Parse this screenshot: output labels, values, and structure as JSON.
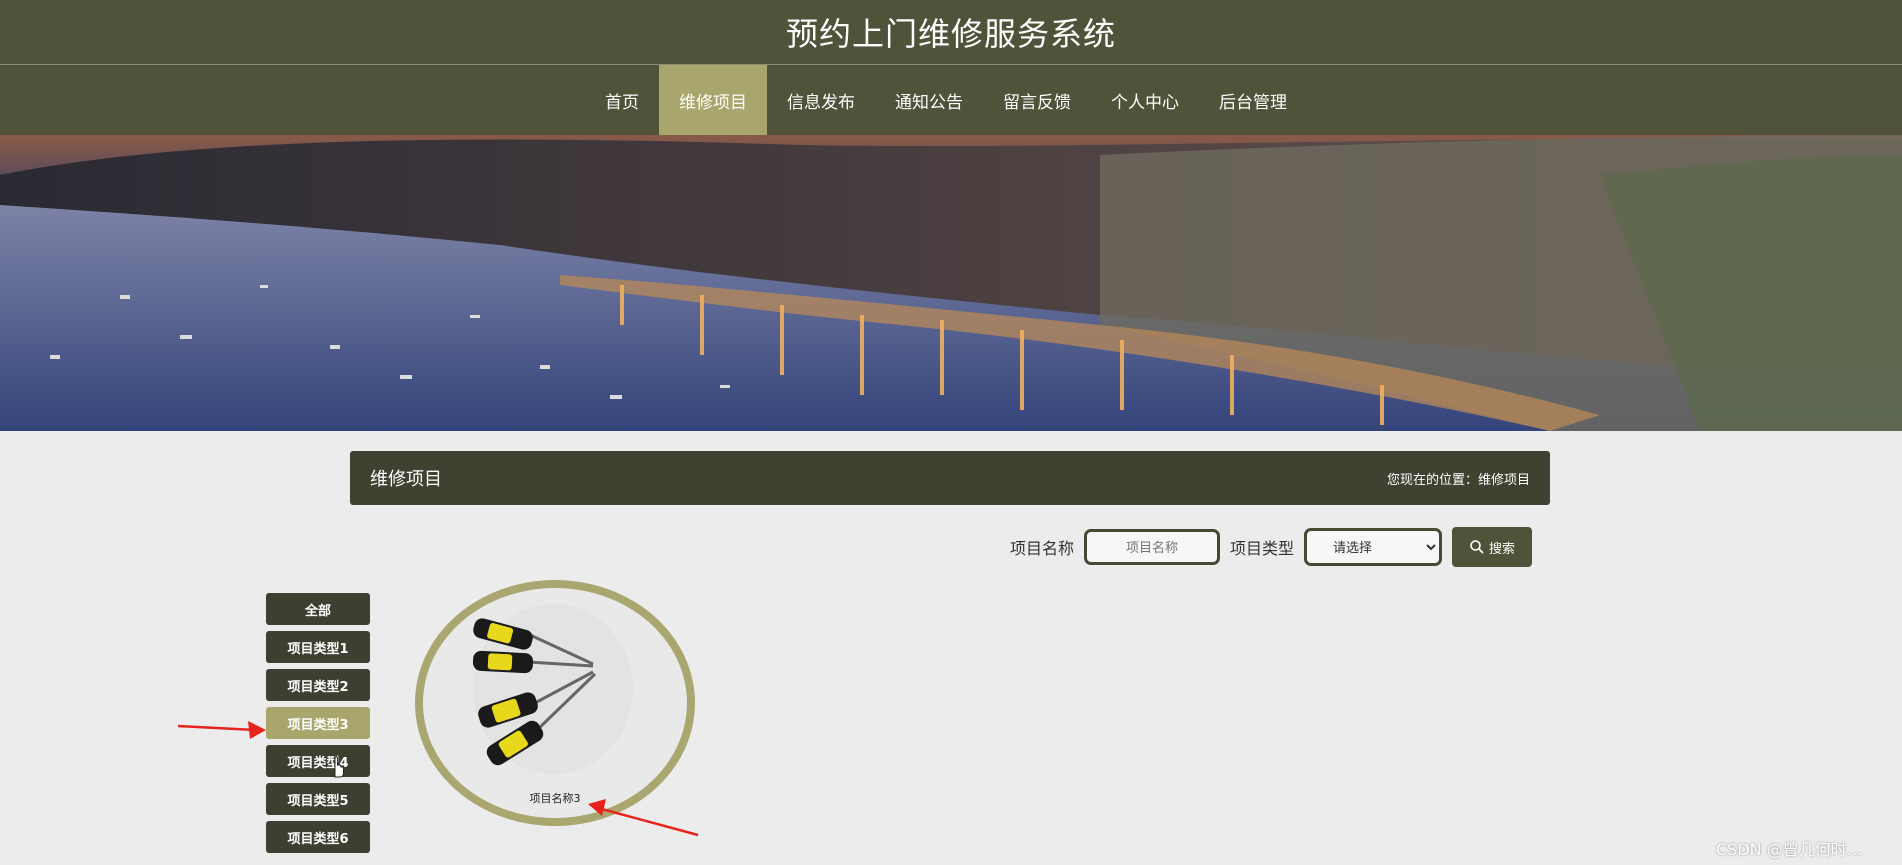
{
  "header": {
    "title": "预约上门维修服务系统"
  },
  "nav": {
    "items": [
      {
        "label": "首页"
      },
      {
        "label": "维修项目",
        "active": true
      },
      {
        "label": "信息发布"
      },
      {
        "label": "通知公告"
      },
      {
        "label": "留言反馈"
      },
      {
        "label": "个人中心"
      },
      {
        "label": "后台管理"
      }
    ]
  },
  "banner": {
    "slide_count": 3,
    "active_slide": 1
  },
  "section": {
    "title": "维修项目",
    "location": "您现在的位置：维修项目"
  },
  "search": {
    "name_label": "项目名称",
    "name_placeholder": "项目名称",
    "type_label": "项目类型",
    "type_selected": "请选择",
    "button_label": "搜索"
  },
  "categories": [
    {
      "label": "全部"
    },
    {
      "label": "项目类型1"
    },
    {
      "label": "项目类型2"
    },
    {
      "label": "项目类型3",
      "active": true
    },
    {
      "label": "项目类型4"
    },
    {
      "label": "项目类型5"
    },
    {
      "label": "项目类型6"
    }
  ],
  "items": [
    {
      "name": "项目名称3",
      "icon": "screwdriver-set-image"
    }
  ],
  "watermark": "CSDN @曾几何时…",
  "colors": {
    "header_bg": "#50533a",
    "accent": "#a8a56d",
    "dark": "#3e4230",
    "annotation_arrow": "#e8231c"
  }
}
